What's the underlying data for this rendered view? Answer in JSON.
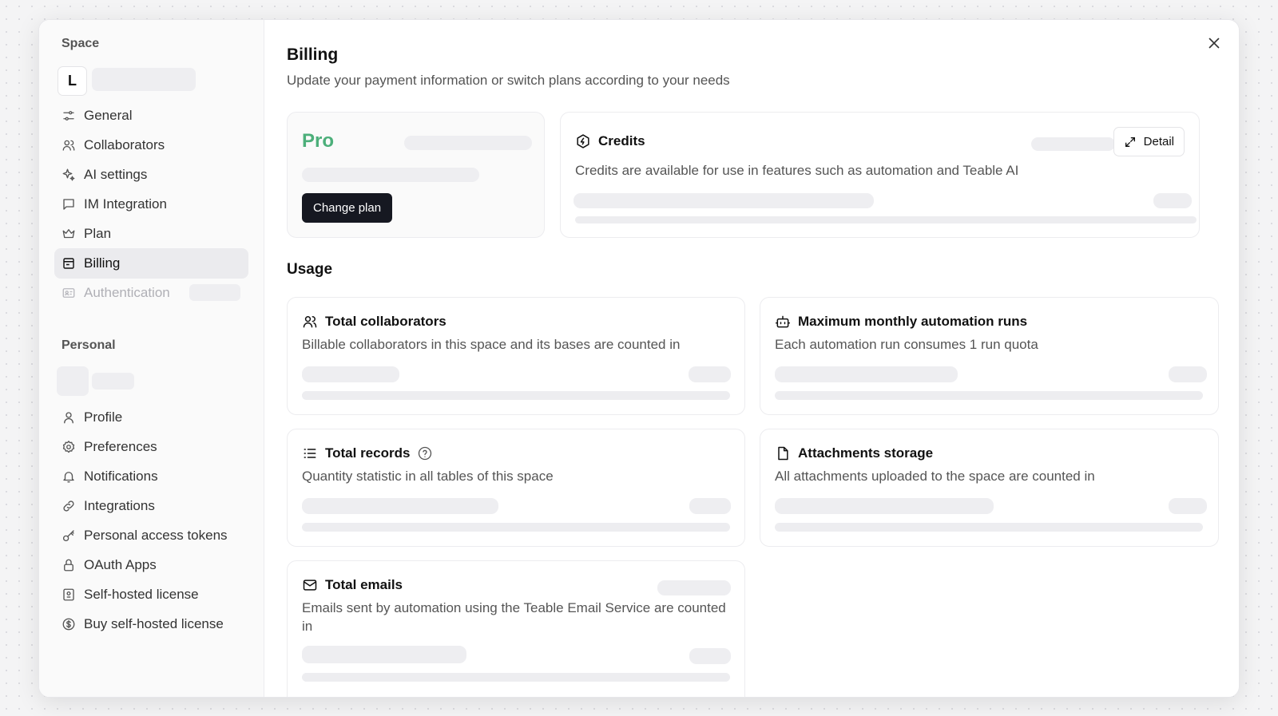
{
  "sidebar": {
    "space_title": "Space",
    "space_avatar": "L",
    "space_items": [
      {
        "label": "General",
        "icon": "sliders-icon"
      },
      {
        "label": "Collaborators",
        "icon": "users-icon"
      },
      {
        "label": "AI settings",
        "icon": "sparkles-icon"
      },
      {
        "label": "IM Integration",
        "icon": "message-icon"
      },
      {
        "label": "Plan",
        "icon": "crown-icon"
      },
      {
        "label": "Billing",
        "icon": "receipt-icon",
        "active": true
      },
      {
        "label": "Authentication",
        "icon": "id-card-icon",
        "disabled": true
      }
    ],
    "personal_title": "Personal",
    "personal_items": [
      {
        "label": "Profile",
        "icon": "user-icon"
      },
      {
        "label": "Preferences",
        "icon": "gear-icon"
      },
      {
        "label": "Notifications",
        "icon": "bell-icon"
      },
      {
        "label": "Integrations",
        "icon": "link-icon"
      },
      {
        "label": "Personal access tokens",
        "icon": "key-icon"
      },
      {
        "label": "OAuth Apps",
        "icon": "lock-icon"
      },
      {
        "label": "Self-hosted license",
        "icon": "license-icon"
      },
      {
        "label": "Buy self-hosted license",
        "icon": "dollar-icon"
      }
    ]
  },
  "main": {
    "title": "Billing",
    "subtitle": "Update your payment information or switch plans according to your needs",
    "plan": {
      "name": "Pro",
      "change_label": "Change plan",
      "accent": "#4caf7a"
    },
    "credits": {
      "title": "Credits",
      "description": "Credits are available for use in features such as automation and Teable AI",
      "detail_label": "Detail"
    },
    "usage_title": "Usage",
    "usage_cards": [
      {
        "title": "Total collaborators",
        "description": "Billable collaborators in this space and its bases are counted in",
        "icon": "users-icon"
      },
      {
        "title": "Maximum monthly automation runs",
        "description": "Each automation run consumes 1 run quota",
        "icon": "bot-icon"
      },
      {
        "title": "Total records",
        "description": "Quantity statistic in all tables of this space",
        "icon": "list-icon",
        "help": true
      },
      {
        "title": "Attachments storage",
        "description": "All attachments uploaded to the space are counted in",
        "icon": "file-icon"
      },
      {
        "title": "Total emails",
        "description": "Emails sent by automation using the Teable Email Service are counted in",
        "icon": "mail-icon"
      }
    ]
  }
}
